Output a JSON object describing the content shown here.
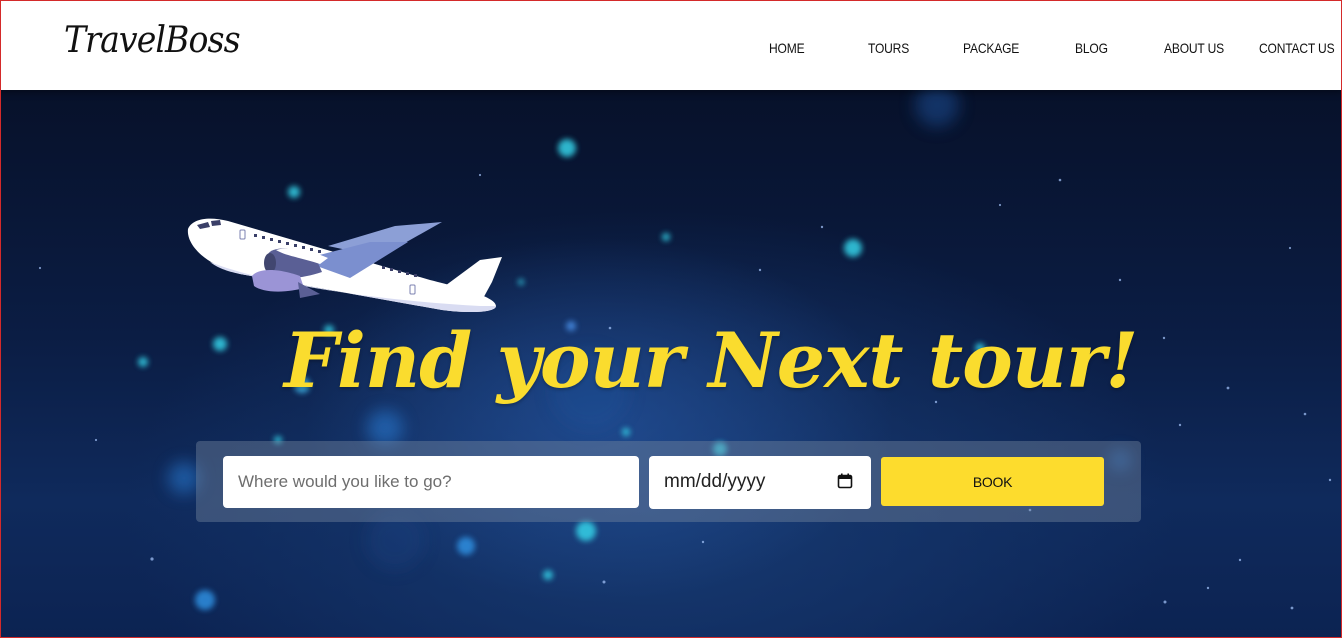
{
  "brand": {
    "logo_text": "TravelBoss"
  },
  "nav": {
    "items": [
      {
        "label": "HOME"
      },
      {
        "label": "TOURS"
      },
      {
        "label": "PACKAGE"
      },
      {
        "label": "BLOG"
      },
      {
        "label": "ABOUT US"
      },
      {
        "label": "CONTACT US"
      }
    ]
  },
  "hero": {
    "headline": "Find your Next tour!",
    "plane_icon": "airplane-illustration"
  },
  "search": {
    "destination_placeholder": "Where would you like to go?",
    "destination_value": "",
    "date_placeholder": "mm/dd/yyyy",
    "date_icon": "calendar-icon",
    "book_label": "BOOK"
  },
  "colors": {
    "accent": "#fddc2d",
    "headline": "#fadc2e",
    "hero_background": "#0b1d44",
    "frame_border": "#d42a2a"
  }
}
